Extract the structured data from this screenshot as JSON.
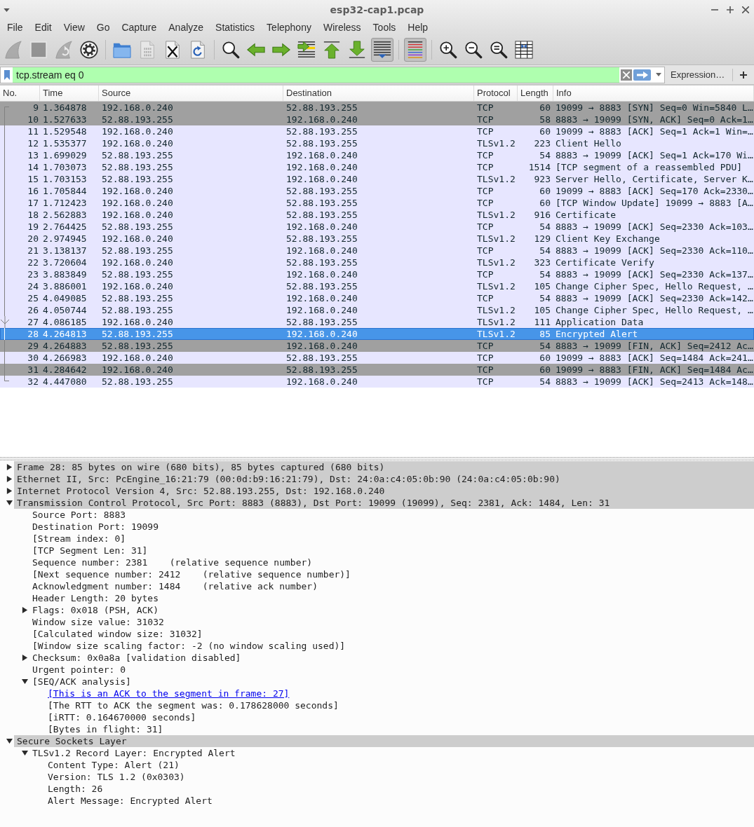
{
  "window": {
    "title": "esp32-cap1.pcap"
  },
  "menu": [
    "File",
    "Edit",
    "View",
    "Go",
    "Capture",
    "Analyze",
    "Statistics",
    "Telephony",
    "Wireless",
    "Tools",
    "Help"
  ],
  "toolbar": [
    {
      "kind": "start",
      "disabled": true,
      "pressed": false
    },
    {
      "kind": "stop",
      "disabled": true,
      "pressed": false
    },
    {
      "kind": "restart",
      "disabled": true,
      "pressed": false
    },
    {
      "kind": "options",
      "disabled": false,
      "pressed": false
    },
    {
      "kind": "separator"
    },
    {
      "kind": "open",
      "disabled": false,
      "pressed": false
    },
    {
      "kind": "save",
      "disabled": true,
      "pressed": false
    },
    {
      "kind": "close",
      "disabled": false,
      "pressed": false
    },
    {
      "kind": "reload",
      "disabled": false,
      "pressed": false
    },
    {
      "kind": "separator"
    },
    {
      "kind": "find",
      "disabled": false,
      "pressed": false
    },
    {
      "kind": "back",
      "disabled": false,
      "pressed": false
    },
    {
      "kind": "forward",
      "disabled": false,
      "pressed": false
    },
    {
      "kind": "goto",
      "disabled": false,
      "pressed": false
    },
    {
      "kind": "first",
      "disabled": false,
      "pressed": false
    },
    {
      "kind": "last",
      "disabled": false,
      "pressed": false
    },
    {
      "kind": "autoscroll",
      "disabled": false,
      "pressed": true
    },
    {
      "kind": "separator"
    },
    {
      "kind": "colorize",
      "disabled": false,
      "pressed": true
    },
    {
      "kind": "separator"
    },
    {
      "kind": "zoomin",
      "disabled": false,
      "pressed": false
    },
    {
      "kind": "zoomout",
      "disabled": false,
      "pressed": false
    },
    {
      "kind": "zoomreset",
      "disabled": false,
      "pressed": false
    },
    {
      "kind": "resize",
      "disabled": false,
      "pressed": false
    }
  ],
  "filter": {
    "value": "tcp.stream eq 0",
    "valid": true,
    "expression_label": "Expression…"
  },
  "packet_list": {
    "columns": [
      "No.",
      "Time",
      "Source",
      "Destination",
      "Protocol",
      "Length",
      "Info"
    ],
    "rows": [
      {
        "no": "9",
        "time": "1.364878",
        "source": "192.168.0.240",
        "destination": "52.88.193.255",
        "protocol": "TCP",
        "length": "60",
        "info": "19099 → 8883 [SYN] Seq=0 Win=5840 L…",
        "color": "#a0a0a0",
        "selected": false,
        "kind": "first",
        "acked": false
      },
      {
        "no": "10",
        "time": "1.527633",
        "source": "52.88.193.255",
        "destination": "192.168.0.240",
        "protocol": "TCP",
        "length": "58",
        "info": "8883 → 19099 [SYN, ACK] Seq=0 Ack=1…",
        "color": "#a0a0a0",
        "selected": false,
        "kind": "middle",
        "acked": false
      },
      {
        "no": "11",
        "time": "1.529548",
        "source": "192.168.0.240",
        "destination": "52.88.193.255",
        "protocol": "TCP",
        "length": "60",
        "info": "19099 → 8883 [ACK] Seq=1 Ack=1 Win=…",
        "color": "#e7e6ff",
        "selected": false,
        "kind": "middle",
        "acked": false
      },
      {
        "no": "12",
        "time": "1.535377",
        "source": "192.168.0.240",
        "destination": "52.88.193.255",
        "protocol": "TLSv1.2",
        "length": "223",
        "info": "Client Hello",
        "color": "#e7e6ff",
        "selected": false,
        "kind": "middle",
        "acked": false
      },
      {
        "no": "13",
        "time": "1.699029",
        "source": "52.88.193.255",
        "destination": "192.168.0.240",
        "protocol": "TCP",
        "length": "54",
        "info": "8883 → 19099 [ACK] Seq=1 Ack=170 Wi…",
        "color": "#e7e6ff",
        "selected": false,
        "kind": "middle",
        "acked": false
      },
      {
        "no": "14",
        "time": "1.703073",
        "source": "52.88.193.255",
        "destination": "192.168.0.240",
        "protocol": "TCP",
        "length": "1514",
        "info": "[TCP segment of a reassembled PDU]",
        "color": "#e7e6ff",
        "selected": false,
        "kind": "middle",
        "acked": false
      },
      {
        "no": "15",
        "time": "1.703153",
        "source": "52.88.193.255",
        "destination": "192.168.0.240",
        "protocol": "TLSv1.2",
        "length": "923",
        "info": "Server Hello, Certificate, Server K…",
        "color": "#e7e6ff",
        "selected": false,
        "kind": "middle",
        "acked": false
      },
      {
        "no": "16",
        "time": "1.705844",
        "source": "192.168.0.240",
        "destination": "52.88.193.255",
        "protocol": "TCP",
        "length": "60",
        "info": "19099 → 8883 [ACK] Seq=170 Ack=2330…",
        "color": "#e7e6ff",
        "selected": false,
        "kind": "middle",
        "acked": false
      },
      {
        "no": "17",
        "time": "1.712423",
        "source": "192.168.0.240",
        "destination": "52.88.193.255",
        "protocol": "TCP",
        "length": "60",
        "info": "[TCP Window Update] 19099 → 8883 [A…",
        "color": "#e7e6ff",
        "selected": false,
        "kind": "middle",
        "acked": false
      },
      {
        "no": "18",
        "time": "2.562883",
        "source": "192.168.0.240",
        "destination": "52.88.193.255",
        "protocol": "TLSv1.2",
        "length": "916",
        "info": "Certificate",
        "color": "#e7e6ff",
        "selected": false,
        "kind": "middle",
        "acked": false
      },
      {
        "no": "19",
        "time": "2.764425",
        "source": "52.88.193.255",
        "destination": "192.168.0.240",
        "protocol": "TCP",
        "length": "54",
        "info": "8883 → 19099 [ACK] Seq=2330 Ack=103…",
        "color": "#e7e6ff",
        "selected": false,
        "kind": "middle",
        "acked": false
      },
      {
        "no": "20",
        "time": "2.974945",
        "source": "192.168.0.240",
        "destination": "52.88.193.255",
        "protocol": "TLSv1.2",
        "length": "129",
        "info": "Client Key Exchange",
        "color": "#e7e6ff",
        "selected": false,
        "kind": "middle",
        "acked": false
      },
      {
        "no": "21",
        "time": "3.138137",
        "source": "52.88.193.255",
        "destination": "192.168.0.240",
        "protocol": "TCP",
        "length": "54",
        "info": "8883 → 19099 [ACK] Seq=2330 Ack=110…",
        "color": "#e7e6ff",
        "selected": false,
        "kind": "middle",
        "acked": false
      },
      {
        "no": "22",
        "time": "3.720604",
        "source": "192.168.0.240",
        "destination": "52.88.193.255",
        "protocol": "TLSv1.2",
        "length": "323",
        "info": "Certificate Verify",
        "color": "#e7e6ff",
        "selected": false,
        "kind": "middle",
        "acked": false
      },
      {
        "no": "23",
        "time": "3.883849",
        "source": "52.88.193.255",
        "destination": "192.168.0.240",
        "protocol": "TCP",
        "length": "54",
        "info": "8883 → 19099 [ACK] Seq=2330 Ack=137…",
        "color": "#e7e6ff",
        "selected": false,
        "kind": "middle",
        "acked": false
      },
      {
        "no": "24",
        "time": "3.886001",
        "source": "192.168.0.240",
        "destination": "52.88.193.255",
        "protocol": "TLSv1.2",
        "length": "105",
        "info": "Change Cipher Spec, Hello Request, …",
        "color": "#e7e6ff",
        "selected": false,
        "kind": "middle",
        "acked": false
      },
      {
        "no": "25",
        "time": "4.049085",
        "source": "52.88.193.255",
        "destination": "192.168.0.240",
        "protocol": "TCP",
        "length": "54",
        "info": "8883 → 19099 [ACK] Seq=2330 Ack=142…",
        "color": "#e7e6ff",
        "selected": false,
        "kind": "middle",
        "acked": false
      },
      {
        "no": "26",
        "time": "4.050744",
        "source": "52.88.193.255",
        "destination": "192.168.0.240",
        "protocol": "TLSv1.2",
        "length": "105",
        "info": "Change Cipher Spec, Hello Request, …",
        "color": "#e7e6ff",
        "selected": false,
        "kind": "middle",
        "acked": false
      },
      {
        "no": "27",
        "time": "4.086185",
        "source": "192.168.0.240",
        "destination": "52.88.193.255",
        "protocol": "TLSv1.2",
        "length": "111",
        "info": "Application Data",
        "color": "#e7e6ff",
        "selected": false,
        "kind": "middle",
        "acked": true
      },
      {
        "no": "28",
        "time": "4.264813",
        "source": "52.88.193.255",
        "destination": "192.168.0.240",
        "protocol": "TLSv1.2",
        "length": "85",
        "info": "Encrypted Alert",
        "selected": true,
        "kind": "middle",
        "acked": false
      },
      {
        "no": "29",
        "time": "4.264883",
        "source": "52.88.193.255",
        "destination": "192.168.0.240",
        "protocol": "TCP",
        "length": "54",
        "info": "8883 → 19099 [FIN, ACK] Seq=2412 Ac…",
        "color": "#a0a0a0",
        "selected": false,
        "kind": "middle",
        "acked": false
      },
      {
        "no": "30",
        "time": "4.266983",
        "source": "192.168.0.240",
        "destination": "52.88.193.255",
        "protocol": "TCP",
        "length": "60",
        "info": "19099 → 8883 [ACK] Seq=1484 Ack=241…",
        "color": "#e7e6ff",
        "selected": false,
        "kind": "middle",
        "acked": false
      },
      {
        "no": "31",
        "time": "4.284642",
        "source": "192.168.0.240",
        "destination": "52.88.193.255",
        "protocol": "TCP",
        "length": "60",
        "info": "19099 → 8883 [FIN, ACK] Seq=1484 Ac…",
        "color": "#a0a0a0",
        "selected": false,
        "kind": "middle",
        "acked": false
      },
      {
        "no": "32",
        "time": "4.447080",
        "source": "52.88.193.255",
        "destination": "192.168.0.240",
        "protocol": "TCP",
        "length": "54",
        "info": "8883 → 19099 [ACK] Seq=2413 Ack=148…",
        "color": "#e7e6ff",
        "selected": false,
        "kind": "last",
        "acked": false
      }
    ]
  },
  "details": [
    {
      "text": "Frame 28: 85 bytes on wire (680 bits), 85 bytes captured (680 bits)",
      "kind": "field",
      "expanded": false
    },
    {
      "text": "Ethernet II, Src: PcEngine_16:21:79 (00:0d:b9:16:21:79), Dst: 24:0a:c4:05:0b:90 (24:0a:c4:05:0b:90)",
      "kind": "field",
      "expanded": false
    },
    {
      "text": "Internet Protocol Version 4, Src: 52.88.193.255, Dst: 192.168.0.240",
      "kind": "field",
      "expanded": false
    },
    {
      "text": "Transmission Control Protocol, Src Port: 8883 (8883), Dst Port: 19099 (19099), Seq: 2381, Ack: 1484, Len: 31",
      "kind": "field",
      "expanded": true,
      "children": [
        {
          "text": "Source Port: 8883",
          "kind": "field"
        },
        {
          "text": "Destination Port: 19099",
          "kind": "field"
        },
        {
          "text": "[Stream index: 0]",
          "kind": "field"
        },
        {
          "text": "[TCP Segment Len: 31]",
          "kind": "field"
        },
        {
          "text": "Sequence number: 2381    (relative sequence number)",
          "kind": "field"
        },
        {
          "text": "[Next sequence number: 2412    (relative sequence number)]",
          "kind": "field"
        },
        {
          "text": "Acknowledgment number: 1484    (relative ack number)",
          "kind": "field"
        },
        {
          "text": "Header Length: 20 bytes",
          "kind": "field"
        },
        {
          "text": "Flags: 0x018 (PSH, ACK)",
          "kind": "field",
          "expanded": false
        },
        {
          "text": "Window size value: 31032",
          "kind": "field"
        },
        {
          "text": "[Calculated window size: 31032]",
          "kind": "field"
        },
        {
          "text": "[Window size scaling factor: -2 (no window scaling used)]",
          "kind": "field"
        },
        {
          "text": "Checksum: 0x0a8a [validation disabled]",
          "kind": "field",
          "expanded": false
        },
        {
          "text": "Urgent pointer: 0",
          "kind": "field"
        },
        {
          "text": "[SEQ/ACK analysis]",
          "kind": "field",
          "expanded": true,
          "children": [
            {
              "text": "[This is an ACK to the segment in frame: 27]",
              "kind": "link"
            },
            {
              "text": "[The RTT to ACK the segment was: 0.178628000 seconds]",
              "kind": "field"
            },
            {
              "text": "[iRTT: 0.164670000 seconds]",
              "kind": "field"
            },
            {
              "text": "[Bytes in flight: 31]",
              "kind": "field"
            }
          ]
        }
      ]
    },
    {
      "text": "Secure Sockets Layer",
      "kind": "field",
      "expanded": true,
      "children": [
        {
          "text": "TLSv1.2 Record Layer: Encrypted Alert",
          "kind": "field",
          "expanded": true,
          "children": [
            {
              "text": "Content Type: Alert (21)",
              "kind": "field"
            },
            {
              "text": "Version: TLS 1.2 (0x0303)",
              "kind": "field"
            },
            {
              "text": "Length: 26",
              "kind": "field"
            },
            {
              "text": "Alert Message: Encrypted Alert",
              "kind": "field"
            }
          ]
        }
      ]
    }
  ]
}
